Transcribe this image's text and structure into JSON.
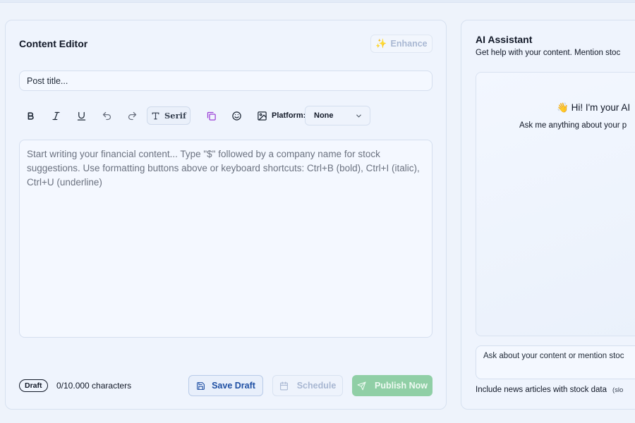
{
  "editor": {
    "title": "Content Editor",
    "enhance_label": "Enhance",
    "title_placeholder": "Post title...",
    "toolbar": {
      "font_label": "Serif",
      "platform_label": "Platform:",
      "platform_value": "None",
      "icons": [
        "bold-icon",
        "italic-icon",
        "underline-icon",
        "undo-icon",
        "redo-icon",
        "text-icon",
        "copy-icon",
        "emoji-icon",
        "image-icon",
        "chevron-down-icon"
      ]
    },
    "content_placeholder": "Start writing your financial content... Type \"$\" followed by a company name for stock suggestions. Use formatting buttons above or keyboard shortcuts: Ctrl+B (bold), Ctrl+I (italic), Ctrl+U (underline)",
    "footer": {
      "status_badge": "Draft",
      "char_count": "0/10.000 characters",
      "save_label": "Save Draft",
      "schedule_label": "Schedule",
      "publish_label": "Publish Now"
    }
  },
  "assistant": {
    "title": "AI Assistant",
    "subtitle": "Get help with your content. Mention stoc",
    "greeting_emoji": "👋",
    "greeting": "Hi! I'm your AI",
    "greeting_sub": "Ask me anything about your p",
    "input_placeholder": "Ask about your content or mention stoc",
    "news_label": "Include news articles with stock data",
    "news_note": "(slo"
  },
  "colors": {
    "background": "#eef3fb",
    "panel": "#eff4fd",
    "primary_blue": "#1e4fa3",
    "publish_green": "#90cfa6",
    "copy_icon_purple": "#9b3fd6"
  }
}
